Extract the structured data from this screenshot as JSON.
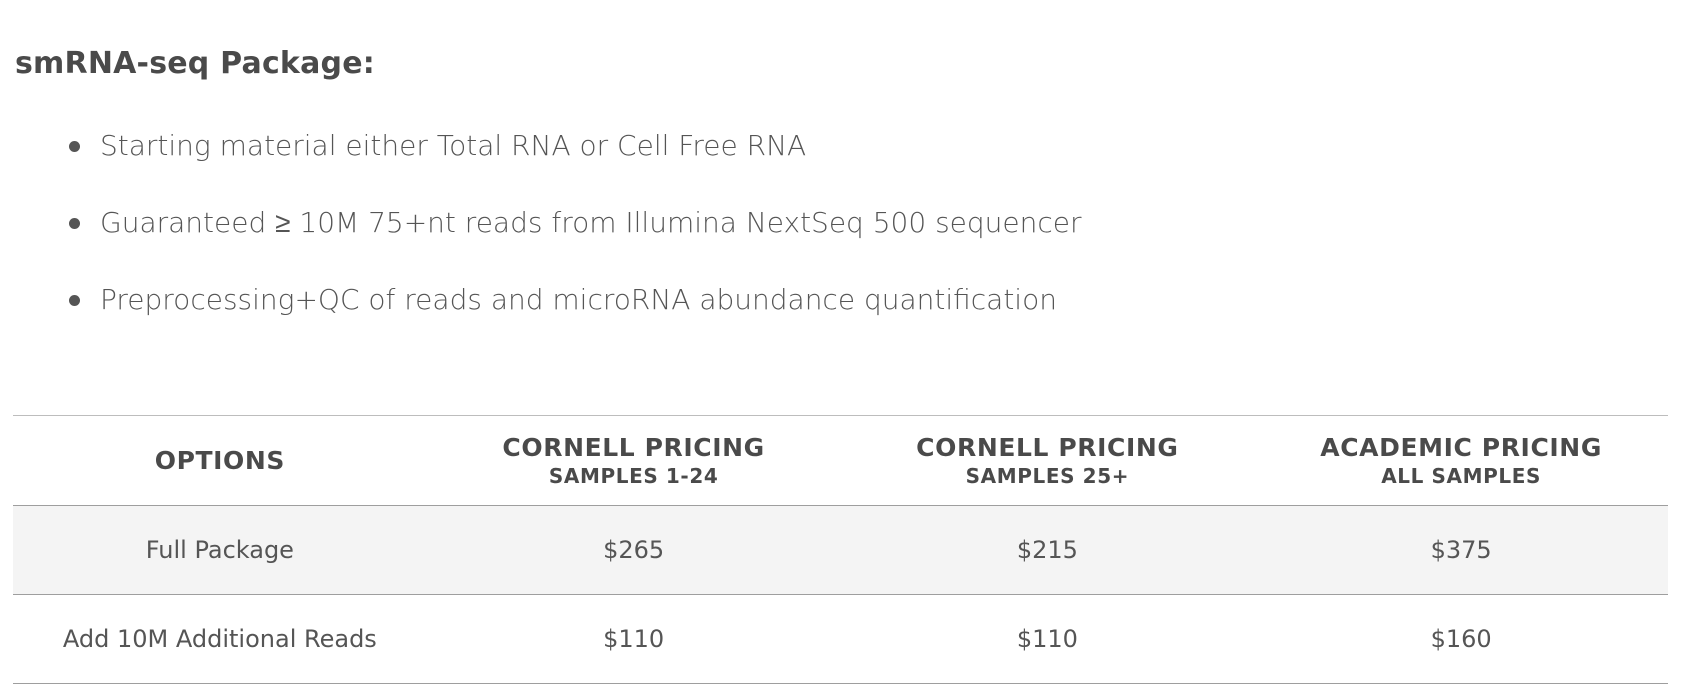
{
  "heading": "smRNA-seq Package:",
  "features": [
    "Starting material either Total RNA or Cell Free RNA",
    "Guaranteed ≥ 10M 75+nt reads from Illumina NextSeq 500 sequencer",
    "Preprocessing+QC of reads and microRNA abundance quantification"
  ],
  "table": {
    "headers": [
      {
        "main": "OPTIONS",
        "sub": ""
      },
      {
        "main": "CORNELL PRICING",
        "sub": "SAMPLES 1-24"
      },
      {
        "main": "CORNELL PRICING",
        "sub": "SAMPLES 25+"
      },
      {
        "main": "ACADEMIC PRICING",
        "sub": "ALL SAMPLES"
      }
    ],
    "rows": [
      [
        "Full Package",
        "$265",
        "$215",
        "$375"
      ],
      [
        "Add 10M Additional Reads",
        "$110",
        "$110",
        "$160"
      ]
    ]
  }
}
